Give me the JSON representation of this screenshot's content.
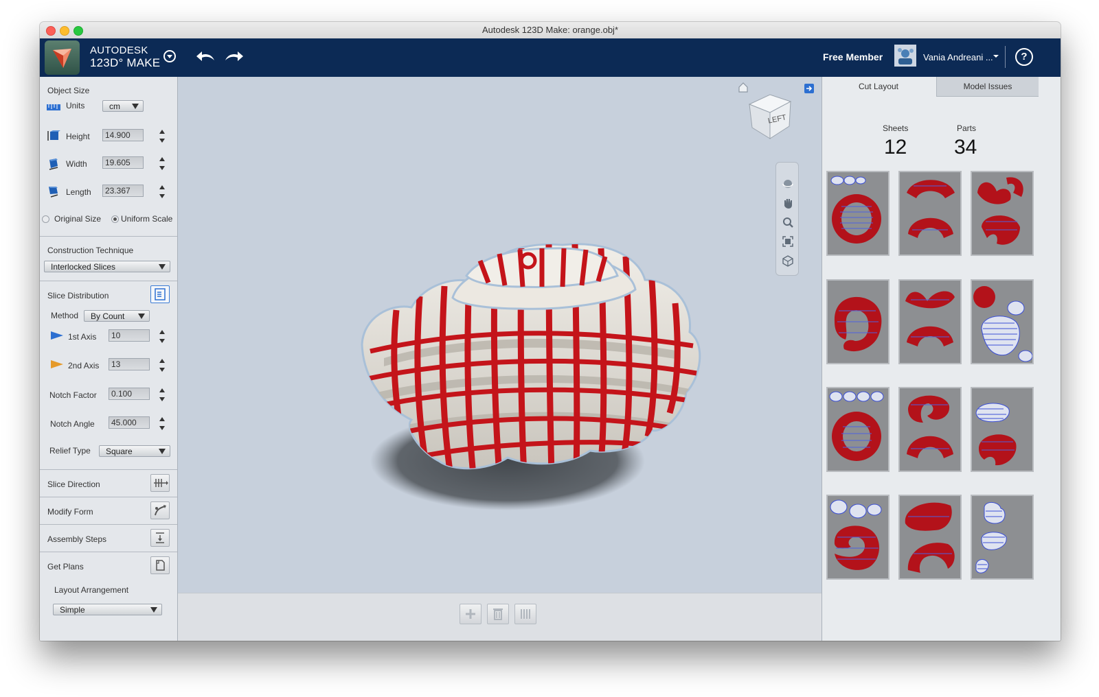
{
  "window": {
    "title": "Autodesk 123D Make: orange.obj*"
  },
  "app": {
    "brand_line1": "AUTODESK",
    "brand_line2": "123D° MAKE",
    "membership": "Free Member",
    "user_name": "Vania Andreani ...",
    "help_label": "?"
  },
  "object_size": {
    "title": "Object Size",
    "units_label": "Units",
    "units_value": "cm",
    "height_label": "Height",
    "height_value": "14.900",
    "width_label": "Width",
    "width_value": "19.605",
    "length_label": "Length",
    "length_value": "23.367",
    "original_size_label": "Original Size",
    "uniform_scale_label": "Uniform Scale"
  },
  "construction": {
    "title": "Construction Technique",
    "technique": "Interlocked Slices"
  },
  "slice_distribution": {
    "title": "Slice Distribution",
    "method_label": "Method",
    "method_value": "By Count",
    "axis1_label": "1st Axis",
    "axis1_value": "10",
    "axis2_label": "2nd Axis",
    "axis2_value": "13",
    "notch_factor_label": "Notch Factor",
    "notch_factor_value": "0.100",
    "notch_angle_label": "Notch Angle",
    "notch_angle_value": "45.000",
    "relief_type_label": "Relief Type",
    "relief_type_value": "Square"
  },
  "sections": {
    "slice_direction": "Slice Direction",
    "modify_form": "Modify Form",
    "assembly_steps": "Assembly Steps",
    "get_plans": "Get Plans",
    "layout_arrangement_label": "Layout Arrangement",
    "layout_arrangement_value": "Simple"
  },
  "viewcube": {
    "face_label": "LEFT"
  },
  "cut_layout": {
    "tab_active": "Cut Layout",
    "tab_inactive": "Model Issues",
    "sheets_label": "Sheets",
    "sheets_value": "12",
    "parts_label": "Parts",
    "parts_value": "34"
  },
  "colors": {
    "app_bar": "#0c2a55",
    "slice_red": "#c4141a",
    "slice_blue": "#3b4fd6",
    "sheet_gray": "#8d8f92",
    "viewport_bg": "#c7d0dc"
  }
}
